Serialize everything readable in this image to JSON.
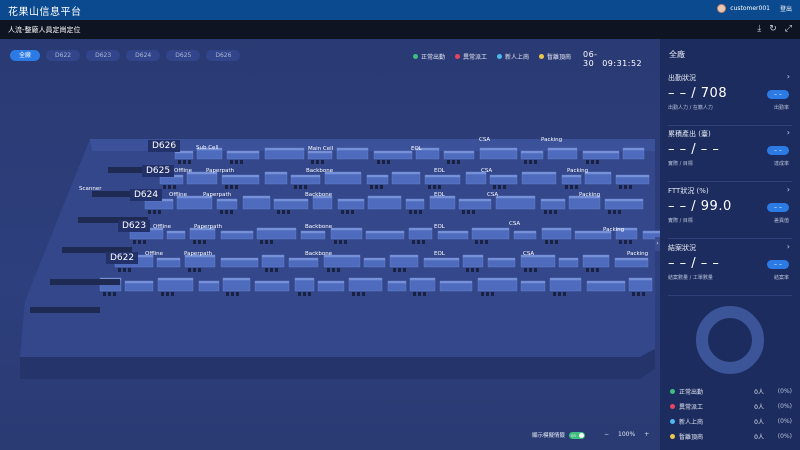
{
  "header": {
    "app_title": "花果山信息平台",
    "username": "customer001",
    "logout_label": "登出"
  },
  "subheader": {
    "page_title": "人流-整廠人員定崗定位",
    "icons": [
      "download-icon",
      "refresh-icon",
      "fullscreen-icon"
    ]
  },
  "floor_tabs": [
    "全廠",
    "D622",
    "D623",
    "D624",
    "D625",
    "D626"
  ],
  "active_tab": "全廠",
  "status_legend": [
    {
      "label": "正常出勤",
      "color": "#3fbf7f"
    },
    {
      "label": "異常派工",
      "color": "#e8455e"
    },
    {
      "label": "新人上崗",
      "color": "#4fb8f0"
    },
    {
      "label": "暫離頂崗",
      "color": "#e8c84a"
    }
  ],
  "datetime": {
    "date": "06-30",
    "time": "09:31:52"
  },
  "floors": [
    "D626",
    "D625",
    "D624",
    "D623",
    "D622"
  ],
  "zone_labels": {
    "scanner": "Scanner",
    "sub_cell": "Sub Cell",
    "main_cell": "Main Cell",
    "offline": "Offline",
    "paperpath": "Paperpath",
    "backbone": "Backbone",
    "eol": "EOL",
    "csa": "CSA",
    "packing": "Packing"
  },
  "map_controls": {
    "mock_label": "顯示模擬情籤",
    "switch_text": "on",
    "zoom_minus": "−",
    "zoom_level": "100%",
    "zoom_plus": "+"
  },
  "panel": {
    "title": "全廠",
    "cards": [
      {
        "title": "出勤狀況",
        "value": "– – / 708",
        "sub": "出勤人力 / 在籍人力",
        "pill": "– –",
        "pill_label": "出勤率"
      },
      {
        "title": "累積產出 (臺)",
        "value": "– – / – –",
        "sub": "實際 / 目標",
        "pill": "– –",
        "pill_label": "達成率"
      },
      {
        "title": "FTT狀況 (%)",
        "value": "– – / 99.0",
        "sub": "實際 / 目標",
        "pill": "– –",
        "pill_label": "差異值"
      },
      {
        "title": "結案狀況",
        "value": "– – / – –",
        "sub": "結案數量 / 工單數量",
        "pill": "– –",
        "pill_label": "結案率"
      }
    ],
    "legend": [
      {
        "label": "正常出勤",
        "color": "#3fbf7f",
        "count": "0人",
        "pct": "(0%)"
      },
      {
        "label": "異常派工",
        "color": "#e8455e",
        "count": "0人",
        "pct": "(0%)"
      },
      {
        "label": "新人上崗",
        "color": "#4fb8f0",
        "count": "0人",
        "pct": "(0%)"
      },
      {
        "label": "暫離頂崗",
        "color": "#e8c84a",
        "count": "0人",
        "pct": "(0%)"
      }
    ]
  }
}
